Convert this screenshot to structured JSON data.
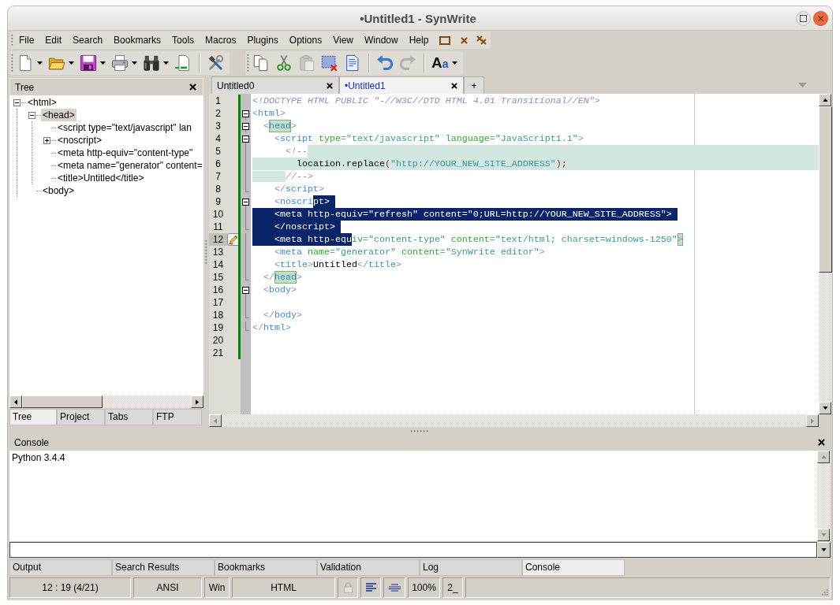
{
  "window": {
    "title": "•Untitled1 - SynWrite"
  },
  "menu": [
    "File",
    "Edit",
    "Search",
    "Bookmarks",
    "Tools",
    "Macros",
    "Plugins",
    "Options",
    "View",
    "Window",
    "Help"
  ],
  "toolbars": [
    [
      {
        "kind": "new",
        "dropdown": true,
        "disabled": false
      },
      {
        "kind": "open",
        "dropdown": true,
        "disabled": false
      },
      {
        "kind": "save",
        "dropdown": true,
        "disabled": false
      },
      {
        "kind": "print",
        "dropdown": true,
        "disabled": false
      },
      {
        "kind": "find",
        "dropdown": true,
        "disabled": false
      },
      {
        "kind": "goto",
        "dropdown": false,
        "disabled": false
      },
      {
        "kind": "separator"
      },
      {
        "kind": "tools",
        "dropdown": false,
        "disabled": false
      }
    ],
    [
      {
        "kind": "copy",
        "dropdown": false,
        "disabled": false
      },
      {
        "kind": "cut",
        "dropdown": false,
        "disabled": false
      },
      {
        "kind": "paste",
        "dropdown": false,
        "disabled": true
      },
      {
        "kind": "delete",
        "dropdown": false,
        "disabled": false
      },
      {
        "kind": "document",
        "dropdown": false,
        "disabled": false
      },
      {
        "kind": "separator"
      },
      {
        "kind": "undo",
        "dropdown": false,
        "disabled": false
      },
      {
        "kind": "redo",
        "dropdown": false,
        "disabled": true
      },
      {
        "kind": "separator"
      },
      {
        "kind": "font",
        "label": "Aa",
        "dropdown": true,
        "disabled": false
      }
    ]
  ],
  "sidebar": {
    "title": "Tree",
    "tree": [
      {
        "label": "<html>",
        "expanded": true,
        "selected": false,
        "children": [
          {
            "label": "<head>",
            "expanded": true,
            "selected": true,
            "children": [
              {
                "label": "<script type=\"text/javascript\" lan",
                "selected": false
              },
              {
                "label": "<noscript>",
                "expanded": false,
                "selected": false
              },
              {
                "label": "<meta http-equiv=\"content-type\"",
                "selected": false
              },
              {
                "label": "<meta name=\"generator\" content=",
                "selected": false
              },
              {
                "label": "<title>Untitled</title>",
                "selected": false
              }
            ]
          },
          {
            "label": "<body>",
            "selected": false
          }
        ]
      }
    ],
    "tabs": [
      {
        "label": "Tree",
        "selected": true
      },
      {
        "label": "Project",
        "selected": false
      },
      {
        "label": "Tabs",
        "selected": false
      },
      {
        "label": "FTP",
        "selected": false
      }
    ]
  },
  "editor": {
    "tabs": [
      {
        "label": "Untitled0",
        "selected": false
      },
      {
        "label": "•Untitled1",
        "selected": true
      }
    ],
    "new_tab": "+",
    "lines": [
      {
        "number": "1",
        "current": false,
        "modified": true,
        "bookmark": false,
        "segments": [
          {
            "kind": "plain",
            "tokens": [
              {
                "text": "<!DOCTYPE HTML PUBLIC \"-//W3C//DTD HTML 4.01 Transitional//EN\">",
                "kind": "doctype"
              }
            ]
          }
        ]
      },
      {
        "number": "2",
        "current": false,
        "modified": true,
        "bookmark": false,
        "fold": {
          "kind": "open"
        },
        "segments": [
          {
            "kind": "plain",
            "tokens": [
              {
                "text": "<",
                "kind": "bracket"
              },
              {
                "text": "html",
                "kind": "tag"
              },
              {
                "text": ">",
                "kind": "bracket"
              }
            ]
          }
        ]
      },
      {
        "number": "3",
        "current": false,
        "modified": true,
        "bookmark": false,
        "fold": {
          "kind": "open"
        },
        "segments": [
          {
            "kind": "plain",
            "tokens": [
              {
                "text": "  <",
                "kind": "bracket"
              }
            ]
          },
          {
            "kind": "match",
            "tokens": [
              {
                "text": "head",
                "kind": "tag"
              }
            ]
          },
          {
            "kind": "plain",
            "tokens": [
              {
                "text": ">",
                "kind": "bracket"
              }
            ]
          }
        ]
      },
      {
        "number": "4",
        "current": false,
        "modified": true,
        "bookmark": false,
        "fold": {
          "kind": "open"
        },
        "segments": [
          {
            "kind": "plain",
            "tokens": [
              {
                "text": "    <",
                "kind": "bracket"
              },
              {
                "text": "script",
                "kind": "tag"
              },
              {
                "text": " type",
                "kind": "attr"
              },
              {
                "text": "=",
                "kind": "bracket"
              },
              {
                "text": "\"text/javascript\"",
                "kind": "value"
              },
              {
                "text": " language",
                "kind": "attr"
              },
              {
                "text": "=",
                "kind": "bracket"
              },
              {
                "text": "\"JavaScript1.1\"",
                "kind": "value"
              },
              {
                "text": ">",
                "kind": "bracket"
              }
            ]
          }
        ]
      },
      {
        "number": "5",
        "current": false,
        "modified": true,
        "bookmark": false,
        "fold": {
          "kind": "line"
        },
        "eol": {
          "kind": "block"
        },
        "segments": [
          {
            "kind": "plain",
            "tokens": [
              {
                "text": "      <!--",
                "kind": "comment"
              }
            ]
          }
        ]
      },
      {
        "number": "6",
        "current": false,
        "modified": true,
        "bookmark": false,
        "fold": {
          "kind": "line"
        },
        "eol": {
          "kind": "block"
        },
        "segments": [
          {
            "kind": "block",
            "tokens": [
              {
                "text": "        location.replace",
                "kind": "text"
              },
              {
                "text": "(",
                "kind": "symbol"
              },
              {
                "text": "\"http://YOUR_NEW_SITE_ADDRESS\"",
                "kind": "value"
              },
              {
                "text": ")",
                "kind": "symbol"
              },
              {
                "text": ";",
                "kind": "symbol"
              }
            ]
          }
        ]
      },
      {
        "number": "7",
        "current": false,
        "modified": true,
        "bookmark": false,
        "fold": {
          "kind": "line"
        },
        "indent": {
          "kind": "block"
        },
        "segments": [
          {
            "kind": "plain",
            "tokens": [
              {
                "text": "      //-->",
                "kind": "comment"
              }
            ]
          }
        ]
      },
      {
        "number": "8",
        "current": false,
        "modified": true,
        "bookmark": false,
        "fold": {
          "kind": "end"
        },
        "segments": [
          {
            "kind": "plain",
            "tokens": [
              {
                "text": "    </",
                "kind": "bracket"
              },
              {
                "text": "script",
                "kind": "tag"
              },
              {
                "text": ">",
                "kind": "bracket"
              }
            ]
          }
        ]
      },
      {
        "number": "9",
        "current": false,
        "modified": true,
        "bookmark": false,
        "fold": {
          "kind": "open"
        },
        "eol": {
          "kind": "selection"
        },
        "segments": [
          {
            "kind": "plain",
            "tokens": [
              {
                "text": "    <",
                "kind": "bracket"
              },
              {
                "text": "noscri",
                "kind": "tag"
              }
            ]
          },
          {
            "kind": "selection",
            "tokens": [
              {
                "text": "pt",
                "kind": "tag"
              },
              {
                "text": ">",
                "kind": "bracket"
              }
            ]
          }
        ]
      },
      {
        "number": "10",
        "current": false,
        "modified": true,
        "bookmark": false,
        "fold": {
          "kind": "line"
        },
        "eol": {
          "kind": "selection"
        },
        "segments": [
          {
            "kind": "selection",
            "tokens": [
              {
                "text": "    <",
                "kind": "bracket"
              },
              {
                "text": "meta",
                "kind": "tag"
              },
              {
                "text": " http-equiv",
                "kind": "attr"
              },
              {
                "text": "=",
                "kind": "bracket"
              },
              {
                "text": "\"refresh\"",
                "kind": "value"
              },
              {
                "text": " content",
                "kind": "attr"
              },
              {
                "text": "=",
                "kind": "bracket"
              },
              {
                "text": "\"0;URL=http://YOUR_NEW_SITE_ADDRESS\"",
                "kind": "value"
              },
              {
                "text": ">",
                "kind": "bracket"
              }
            ]
          }
        ]
      },
      {
        "number": "11",
        "current": false,
        "modified": true,
        "bookmark": false,
        "fold": {
          "kind": "end"
        },
        "eol": {
          "kind": "selection"
        },
        "segments": [
          {
            "kind": "selection",
            "tokens": [
              {
                "text": "    </",
                "kind": "bracket"
              },
              {
                "text": "noscript",
                "kind": "tag"
              },
              {
                "text": ">",
                "kind": "bracket"
              }
            ]
          }
        ]
      },
      {
        "number": "12",
        "current": true,
        "modified": true,
        "bookmark": true,
        "fold": {
          "kind": "line"
        },
        "segments": [
          {
            "kind": "selection",
            "tokens": [
              {
                "text": "    <",
                "kind": "bracket"
              },
              {
                "text": "meta",
                "kind": "tag"
              },
              {
                "text": " http-equ",
                "kind": "attr"
              }
            ]
          },
          {
            "kind": "plain",
            "tokens": [
              {
                "text": "iv",
                "kind": "attr"
              },
              {
                "text": "=",
                "kind": "bracket"
              },
              {
                "text": "\"content-type\"",
                "kind": "value"
              },
              {
                "text": " content",
                "kind": "attr"
              },
              {
                "text": "=",
                "kind": "bracket"
              },
              {
                "text": "\"text/html; charset=windows-1250\"",
                "kind": "value"
              }
            ]
          },
          {
            "kind": "match",
            "tokens": [
              {
                "text": ">",
                "kind": "bracket"
              }
            ]
          }
        ]
      },
      {
        "number": "13",
        "current": false,
        "modified": true,
        "bookmark": false,
        "fold": {
          "kind": "line"
        },
        "segments": [
          {
            "kind": "plain",
            "tokens": [
              {
                "text": "    <",
                "kind": "bracket"
              },
              {
                "text": "meta",
                "kind": "tag"
              },
              {
                "text": " name",
                "kind": "attr"
              },
              {
                "text": "=",
                "kind": "bracket"
              },
              {
                "text": "\"generator\"",
                "kind": "value"
              },
              {
                "text": " content",
                "kind": "attr"
              },
              {
                "text": "=",
                "kind": "bracket"
              },
              {
                "text": "\"SynWrite editor\"",
                "kind": "value"
              },
              {
                "text": ">",
                "kind": "bracket"
              }
            ]
          }
        ]
      },
      {
        "number": "14",
        "current": false,
        "modified": true,
        "bookmark": false,
        "fold": {
          "kind": "line"
        },
        "segments": [
          {
            "kind": "plain",
            "tokens": [
              {
                "text": "    <",
                "kind": "bracket"
              },
              {
                "text": "title",
                "kind": "tag"
              },
              {
                "text": ">",
                "kind": "bracket"
              },
              {
                "text": "Untitled",
                "kind": "text"
              },
              {
                "text": "</",
                "kind": "bracket"
              },
              {
                "text": "title",
                "kind": "tag"
              },
              {
                "text": ">",
                "kind": "bracket"
              }
            ]
          }
        ]
      },
      {
        "number": "15",
        "current": false,
        "modified": true,
        "bookmark": false,
        "fold": {
          "kind": "end"
        },
        "segments": [
          {
            "kind": "plain",
            "tokens": [
              {
                "text": "  </",
                "kind": "bracket"
              }
            ]
          },
          {
            "kind": "match",
            "tokens": [
              {
                "text": "head",
                "kind": "tag"
              }
            ]
          },
          {
            "kind": "plain",
            "tokens": [
              {
                "text": ">",
                "kind": "bracket"
              }
            ]
          }
        ]
      },
      {
        "number": "16",
        "current": false,
        "modified": true,
        "bookmark": false,
        "fold": {
          "kind": "open"
        },
        "segments": [
          {
            "kind": "plain",
            "tokens": [
              {
                "text": "  <",
                "kind": "bracket"
              },
              {
                "text": "body",
                "kind": "tag"
              },
              {
                "text": ">",
                "kind": "bracket"
              }
            ]
          }
        ]
      },
      {
        "number": "17",
        "current": false,
        "modified": true,
        "bookmark": false,
        "fold": {
          "kind": "line"
        }
      },
      {
        "number": "18",
        "current": false,
        "modified": true,
        "bookmark": false,
        "fold": {
          "kind": "end"
        },
        "segments": [
          {
            "kind": "plain",
            "tokens": [
              {
                "text": "  </",
                "kind": "bracket"
              },
              {
                "text": "body",
                "kind": "tag"
              },
              {
                "text": ">",
                "kind": "bracket"
              }
            ]
          }
        ]
      },
      {
        "number": "19",
        "current": false,
        "modified": true,
        "bookmark": false,
        "fold": {
          "kind": "end"
        },
        "segments": [
          {
            "kind": "plain",
            "tokens": [
              {
                "text": "</",
                "kind": "bracket"
              },
              {
                "text": "html",
                "kind": "tag"
              },
              {
                "text": ">",
                "kind": "bracket"
              }
            ]
          }
        ]
      },
      {
        "number": "20",
        "current": false,
        "modified": true,
        "bookmark": false
      },
      {
        "number": "21",
        "current": false,
        "modified": true,
        "bookmark": false
      }
    ]
  },
  "console": {
    "title": "Console",
    "output": [
      "Python 3.4.4"
    ],
    "tabs": [
      {
        "label": "Output",
        "selected": false
      },
      {
        "label": "Search Results",
        "selected": false
      },
      {
        "label": "Bookmarks",
        "selected": false
      },
      {
        "label": "Validation",
        "selected": false
      },
      {
        "label": "Log",
        "selected": false
      },
      {
        "label": "Console",
        "selected": true
      }
    ]
  },
  "status_bar": {
    "caret": "12 : 19 (4/21)",
    "encoding": "ANSI",
    "line_endings": "Win",
    "lexer": "HTML",
    "read_only": false,
    "zoom": "100%",
    "cell_9": "2_"
  }
}
